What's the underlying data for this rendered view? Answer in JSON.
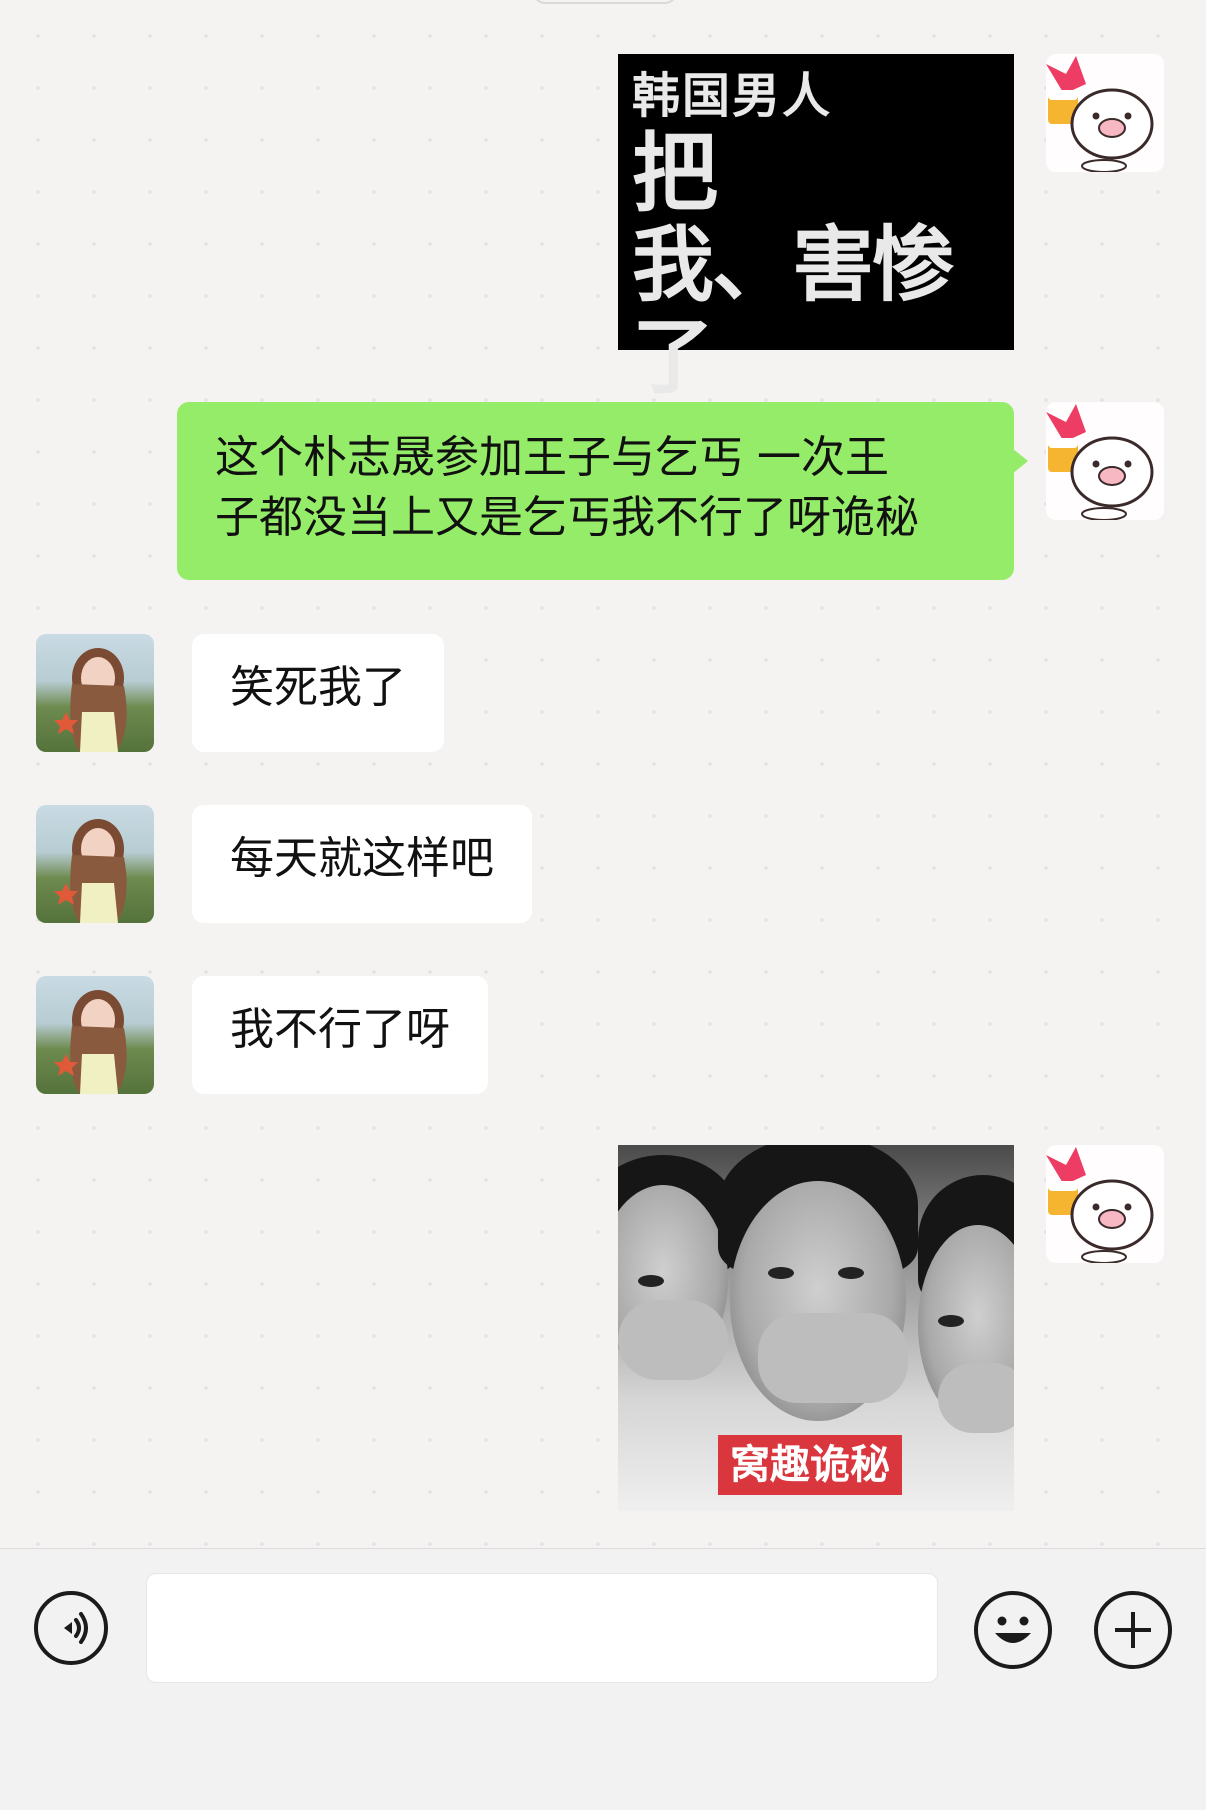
{
  "chat": {
    "messages": [
      {
        "side": "out",
        "type": "image",
        "caption": [
          "韩国男人",
          "把",
          "我、害惨了"
        ]
      },
      {
        "side": "out",
        "type": "text",
        "text_lines": [
          "这个朴志晟参加王子与乞丐 一次王",
          "子都没当上又是乞丐我不行了呀诡秘"
        ]
      },
      {
        "side": "in",
        "type": "text",
        "text": "笑死我了"
      },
      {
        "side": "in",
        "type": "text",
        "text": "每天就这样吧"
      },
      {
        "side": "in",
        "type": "text",
        "text": "我不行了呀"
      },
      {
        "side": "out",
        "type": "image",
        "caption": "窝趣诡秘"
      }
    ]
  },
  "input_bar": {
    "value": "",
    "icons": {
      "voice": "voice-icon",
      "emoji": "emoji-icon",
      "more": "plus-icon"
    }
  },
  "colors": {
    "outgoing_bubble": "#95ec69",
    "incoming_bubble": "#ffffff",
    "background": "#f4f3f2"
  }
}
